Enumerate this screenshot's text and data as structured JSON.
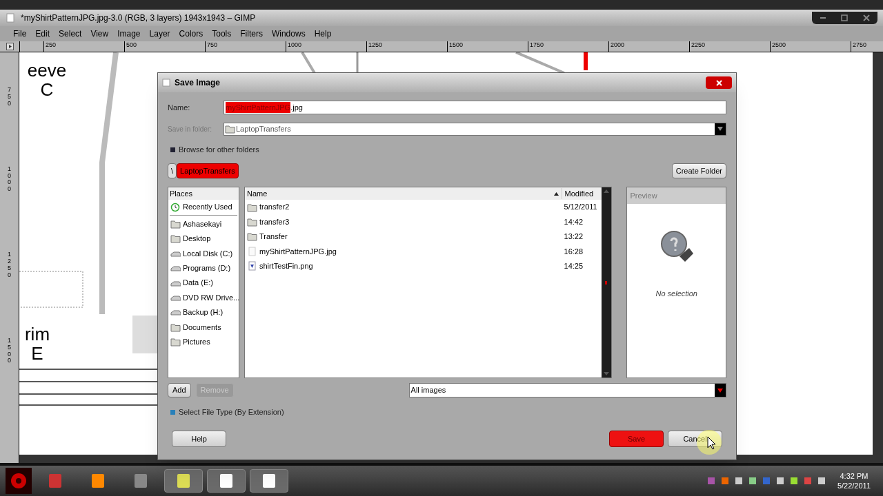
{
  "window": {
    "title": "*myShirtPatternJPG.jpg-3.0 (RGB, 3 layers) 1943x1943 – GIMP"
  },
  "menu": [
    "File",
    "Edit",
    "Select",
    "View",
    "Image",
    "Layer",
    "Colors",
    "Tools",
    "Filters",
    "Windows",
    "Help"
  ],
  "ruler": {
    "horizontal": [
      "250",
      "500",
      "750",
      "1000",
      "1250",
      "1500",
      "1750",
      "2000",
      "2250",
      "2500",
      "2750"
    ],
    "vertical": [
      "750",
      "1000",
      "1250",
      "1500"
    ]
  },
  "canvas_texts": [
    "eeve",
    "C",
    "rim",
    "E"
  ],
  "dialog": {
    "title": "Save Image",
    "name_label": "Name:",
    "name_selected": "myShirtPatternJPG",
    "name_rest": ".jpg",
    "folder_label": "Save in folder:",
    "folder_value": "LaptopTransfers",
    "browse": {
      "label": "Browse for other folders",
      "expanded": true
    },
    "path_buttons": [
      {
        "label": "\\",
        "selected": false
      },
      {
        "label": "LaptopTransfers",
        "selected": true
      }
    ],
    "create_folder": "Create Folder",
    "places_header": "Places",
    "places": [
      {
        "label": "Recently Used",
        "kind": "recent"
      },
      {
        "label": "Ashasekayi",
        "kind": "folder"
      },
      {
        "label": "Desktop",
        "kind": "folder"
      },
      {
        "label": "Local Disk (C:)",
        "kind": "drive"
      },
      {
        "label": "Programs (D:)",
        "kind": "drive"
      },
      {
        "label": "Data (E:)",
        "kind": "drive"
      },
      {
        "label": "DVD RW Drive...",
        "kind": "drive"
      },
      {
        "label": "Backup (H:)",
        "kind": "drive"
      },
      {
        "label": "Documents",
        "kind": "folder"
      },
      {
        "label": "Pictures",
        "kind": "folder"
      }
    ],
    "columns": [
      "Name",
      "Modified"
    ],
    "files": [
      {
        "name": "transfer2",
        "modified": "5/12/2011",
        "kind": "folder"
      },
      {
        "name": "transfer3",
        "modified": "14:42",
        "kind": "folder"
      },
      {
        "name": "Transfer",
        "modified": "13:22",
        "kind": "folder"
      },
      {
        "name": "myShirtPatternJPG.jpg",
        "modified": "16:28",
        "kind": "file"
      },
      {
        "name": "shirtTestFin.png",
        "modified": "14:25",
        "kind": "image"
      }
    ],
    "preview_title": "Preview",
    "preview_text": "No selection",
    "add": {
      "label": "Add",
      "disabled": false
    },
    "remove": {
      "label": "Remove",
      "disabled": true
    },
    "filter": "All images",
    "file_type": {
      "label": "Select File Type (By Extension)",
      "expanded": false
    },
    "help": "Help",
    "save": "Save",
    "cancel": "Cancel"
  },
  "taskbar": {
    "time": "4:32 PM",
    "date": "5/22/2011"
  }
}
